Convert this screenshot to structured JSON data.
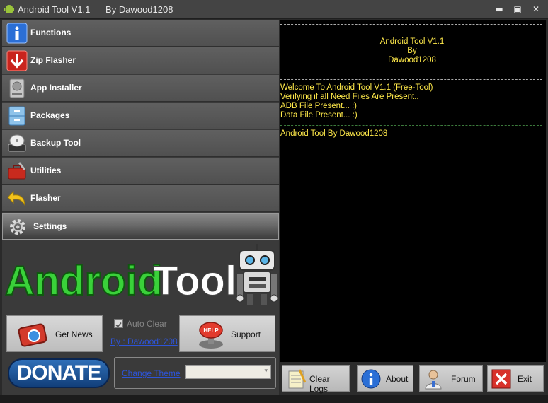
{
  "window": {
    "title": "Android Tool V1.1      By Dawood1208",
    "minimize": "▬",
    "maximize": "▣",
    "close": "✕"
  },
  "menu": [
    {
      "label": "Functions",
      "icon": "info-icon"
    },
    {
      "label": "Zip Flasher",
      "icon": "down-arrow-icon"
    },
    {
      "label": "App Installer",
      "icon": "hard-drive-icon"
    },
    {
      "label": "Packages",
      "icon": "cabinet-icon"
    },
    {
      "label": "Backup Tool",
      "icon": "backup-disk-icon"
    },
    {
      "label": "Utilities",
      "icon": "toolbox-icon"
    },
    {
      "label": "Flasher",
      "icon": "undo-arrow-icon"
    },
    {
      "label": "Settings",
      "icon": "gear-icon",
      "active": true
    }
  ],
  "logo": {
    "text_a": "Android",
    "text_b": "Tool"
  },
  "left_controls": {
    "get_news": "Get News",
    "auto_clear": "Auto Clear",
    "auto_clear_checked": true,
    "by_link": "By : Dawood1208",
    "support": "Support",
    "donate": "DONATE",
    "change_theme": "Change Theme",
    "theme_value": ""
  },
  "console": {
    "header": [
      "Android Tool V1.1",
      "By",
      "Dawood1208"
    ],
    "lines": [
      "Welcome To Android Tool V1.1 (Free-Tool)",
      "Verifying if all Need Files Are Present..",
      "ADB File Present... :)",
      "Data File Present... :)"
    ],
    "footer_line": "Android Tool By Dawood1208",
    "text_color": "#ffe94a"
  },
  "bottom_buttons": [
    {
      "label": "Clear Logs",
      "icon": "notepad-icon"
    },
    {
      "label": "About",
      "icon": "info-icon"
    },
    {
      "label": "Forum",
      "icon": "user-icon"
    },
    {
      "label": "Exit",
      "icon": "close-icon"
    }
  ],
  "colors": {
    "accent_green": "#3ad13a",
    "link": "#2d54d8",
    "panel": "#3a3a3a"
  }
}
